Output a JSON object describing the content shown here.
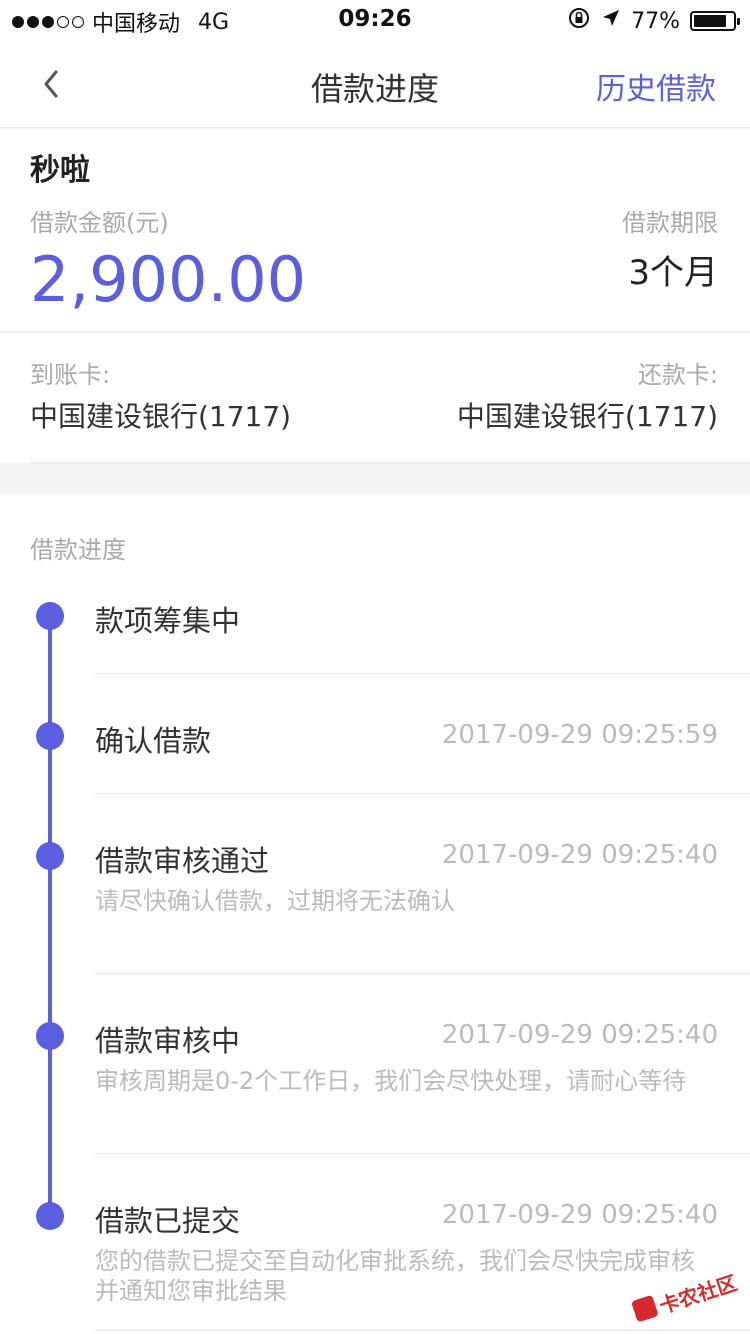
{
  "status": {
    "carrier": "中国移动",
    "network": "4G",
    "time": "09:26",
    "battery": "77%"
  },
  "nav": {
    "title": "借款进度",
    "right_link": "历史借款"
  },
  "loan": {
    "app_name": "秒啦",
    "amount_label": "借款金额(元)",
    "amount_value": "2,900.00",
    "term_label": "借款期限",
    "term_value": "3个月",
    "receive_label": "到账卡:",
    "receive_value": "中国建设银行(1717)",
    "repay_label": "还款卡:",
    "repay_value": "中国建设银行(1717)"
  },
  "progress": {
    "title": "借款进度",
    "steps": [
      {
        "title": "款项筹集中",
        "time": "",
        "desc": ""
      },
      {
        "title": "确认借款",
        "time": "2017-09-29 09:25:59",
        "desc": ""
      },
      {
        "title": "借款审核通过",
        "time": "2017-09-29 09:25:40",
        "desc": "请尽快确认借款，过期将无法确认"
      },
      {
        "title": "借款审核中",
        "time": "2017-09-29 09:25:40",
        "desc": "审核周期是0-2个工作日，我们会尽快处理，请耐心等待"
      },
      {
        "title": "借款已提交",
        "time": "2017-09-29 09:25:40",
        "desc": "您的借款已提交至自动化审批系统，我们会尽快完成审核并通知您审批结果"
      }
    ]
  },
  "watermark": "卡农社区",
  "colors": {
    "accent": "#5a5fe0",
    "watermark": "#d62a2a"
  },
  "icons": [
    "back-chevron-icon",
    "signal-dots-icon",
    "orientation-lock-icon",
    "location-arrow-icon",
    "battery-icon"
  ]
}
